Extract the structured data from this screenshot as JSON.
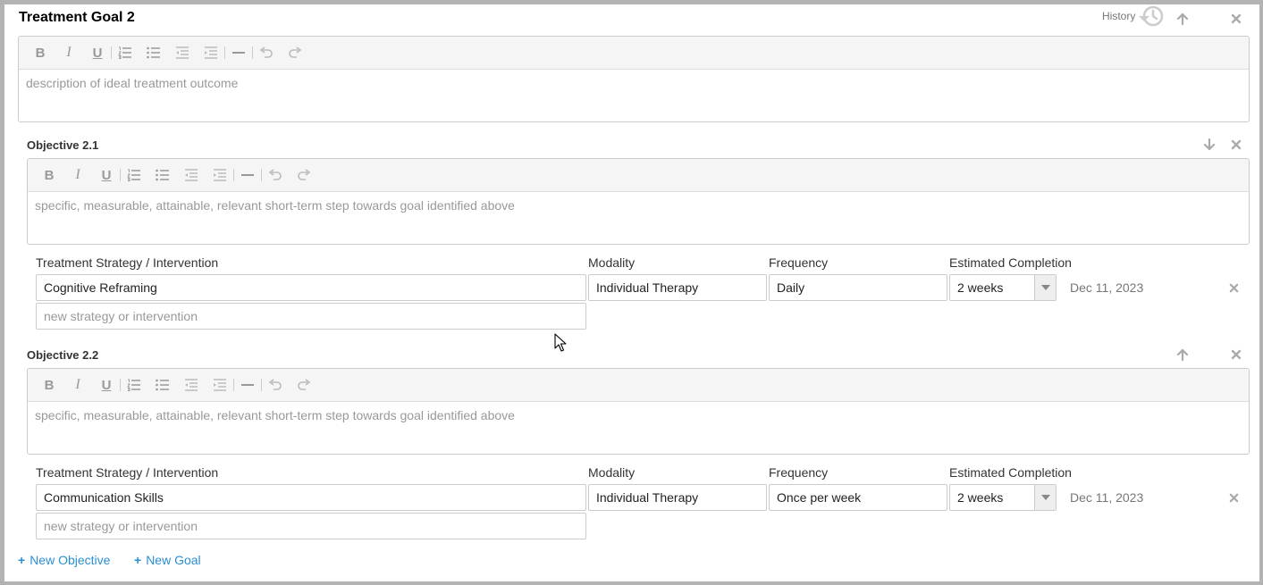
{
  "goal": {
    "title": "Treatment Goal 2",
    "history_label": "History",
    "description_placeholder": "description of ideal treatment outcome"
  },
  "headers": {
    "strategy": "Treatment Strategy / Intervention",
    "modality": "Modality",
    "frequency": "Frequency",
    "completion": "Estimated Completion"
  },
  "objectives": [
    {
      "title": "Objective 2.1",
      "placeholder": "specific, measurable, attainable, relevant short-term step towards goal identified above",
      "strategy": "Cognitive Reframing",
      "modality": "Individual Therapy",
      "frequency": "Daily",
      "completion": "2 weeks",
      "date": "Dec 11, 2023",
      "new_strategy_placeholder": "new strategy or intervention"
    },
    {
      "title": "Objective 2.2",
      "placeholder": "specific, measurable, attainable, relevant short-term step towards goal identified above",
      "strategy": "Communication Skills",
      "modality": "Individual Therapy",
      "frequency": "Once per week",
      "completion": "2 weeks",
      "date": "Dec 11, 2023",
      "new_strategy_placeholder": "new strategy or intervention"
    }
  ],
  "actions": {
    "new_objective": "New Objective",
    "new_goal": "New Goal",
    "plus": "+"
  },
  "toolbar": {
    "bold": "B",
    "italic": "I",
    "underline": "U"
  },
  "colors": {
    "link": "#2a8fd0",
    "frame": "#b3b3b3",
    "toolbar_bg": "#f5f5f5"
  }
}
